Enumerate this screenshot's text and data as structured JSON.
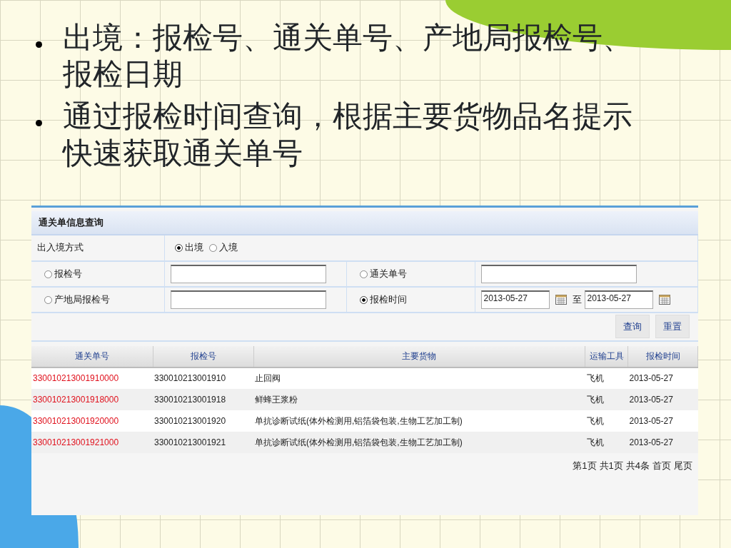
{
  "bullets": [
    {
      "text": "出境：报检号、通关单号、产地局报检号、报检日期"
    },
    {
      "text": "通过报检时间查询，根据主要货物品名提示快速获取通关单号"
    }
  ],
  "query_panel": {
    "title": "通关单信息查询",
    "direction": {
      "label": "出入境方式",
      "options": [
        {
          "label": "出境",
          "selected": true
        },
        {
          "label": "入境",
          "selected": false
        }
      ]
    },
    "fields": [
      {
        "kind": "text",
        "label": "报检号",
        "selected": false
      },
      {
        "kind": "text",
        "label": "通关单号",
        "selected": false
      },
      {
        "kind": "text",
        "label": "产地局报检号",
        "selected": false
      },
      {
        "kind": "date_range",
        "label": "报检时间",
        "selected": true,
        "from": "2013-05-27",
        "separator": "至",
        "to": "2013-05-27"
      }
    ],
    "buttons": [
      "查询",
      "重置"
    ]
  },
  "table": {
    "columns": [
      "通关单号",
      "报检号",
      "主要货物",
      "运输工具",
      "报检时间"
    ],
    "rows": [
      [
        "330010213001910000",
        "330010213001910",
        "止回阀",
        "飞机",
        "2013-05-27"
      ],
      [
        "330010213001918000",
        "330010213001918",
        "鲜蜂王浆粉",
        "飞机",
        "2013-05-27"
      ],
      [
        "330010213001920000",
        "330010213001920",
        "单抗诊断试纸(体外检测用,铝箔袋包装,生物工艺加工制)",
        "飞机",
        "2013-05-27"
      ],
      [
        "330010213001921000",
        "330010213001921",
        "单抗诊断试纸(体外检测用,铝箔袋包装,生物工艺加工制)",
        "飞机",
        "2013-05-27"
      ]
    ]
  },
  "pager": [
    "第1页",
    "共1页",
    "共4条",
    "首页",
    "尾页"
  ]
}
